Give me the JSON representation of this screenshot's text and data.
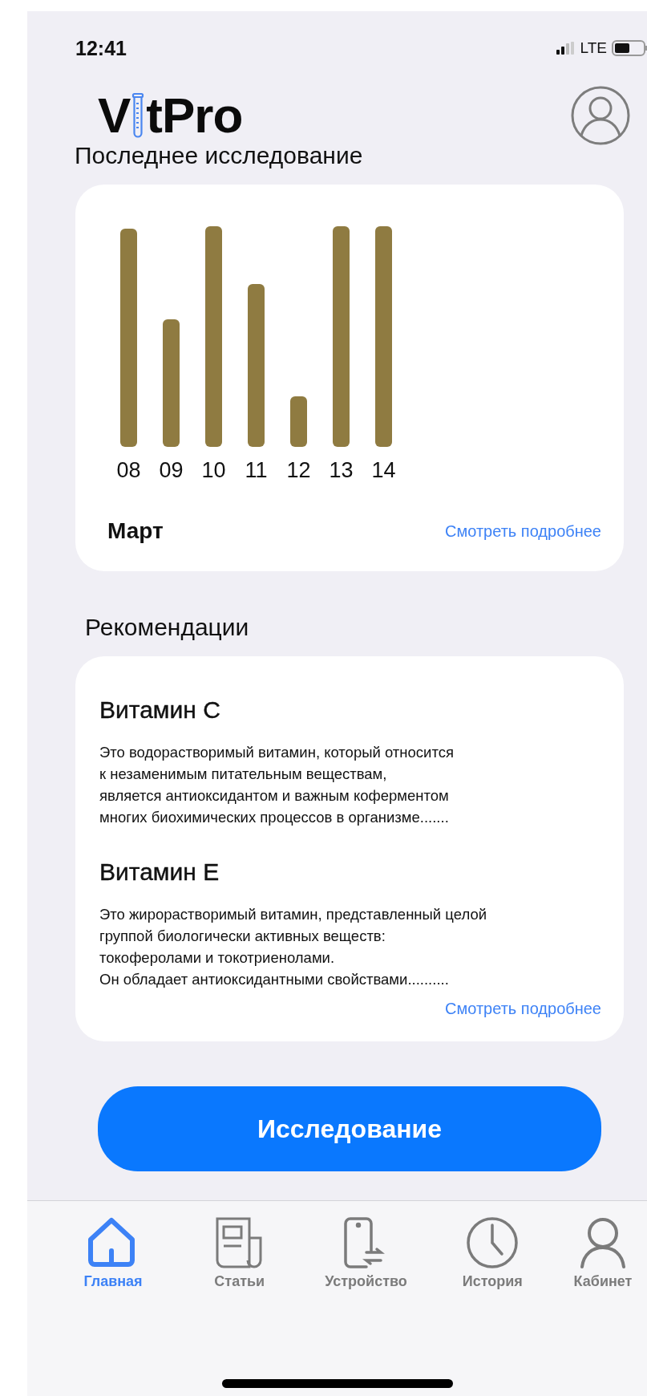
{
  "status_bar": {
    "time": "12:41",
    "network": "LTE"
  },
  "header": {
    "logo_before": "V",
    "logo_after": "tPro"
  },
  "section_title": "Последнее исследование",
  "latest_study": {
    "day_labels": [
      "08",
      "09",
      "10",
      "11",
      "12",
      "13",
      "14"
    ],
    "month": "Март",
    "more_link": "Смотреть подробнее"
  },
  "recommendations": {
    "title": "Рекомендации",
    "items": [
      {
        "name": "Витамин С",
        "text": "Это водорастворимый витамин, который относится\nк незаменимым питательным веществам,\nявляется антиоксидантом и важным коферментом\nмногих биохимических процессов в организме......."
      },
      {
        "name": "Витамин Е",
        "text": "Это жирорастворимый витамин, представленный целой\nгруппой биологически активных веществ:\nтокоферолами и токотриенолами.\nОн обладает антиоксидантными свойствами.........."
      }
    ],
    "more_link": "Смотреть подробнее"
  },
  "primary_button": "Исследование",
  "tab_bar": [
    {
      "kind": "home",
      "label": "Главная",
      "selected": true
    },
    {
      "kind": "articles",
      "label": "Статьи",
      "selected": false
    },
    {
      "kind": "device",
      "label": "Устройство",
      "selected": false
    },
    {
      "kind": "history",
      "label": "История",
      "selected": false
    },
    {
      "kind": "account",
      "label": "Кабинет",
      "selected": false
    }
  ]
}
